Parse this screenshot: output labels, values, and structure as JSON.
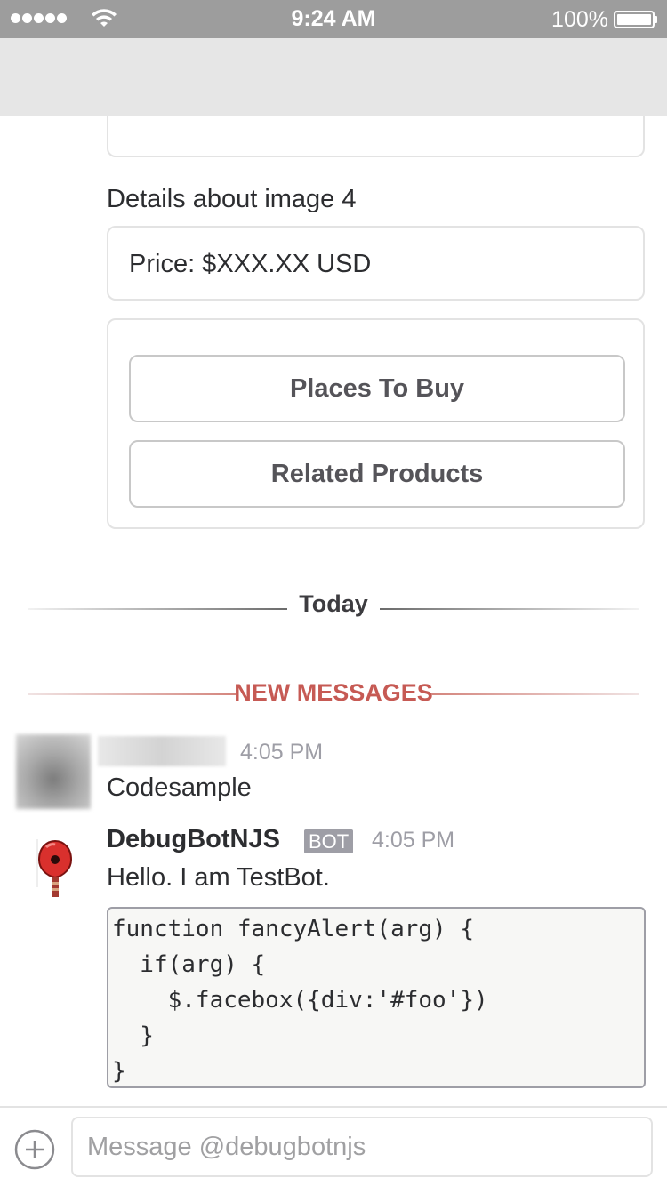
{
  "status_bar": {
    "time": "9:24 AM",
    "battery_percent": "100%",
    "signal_bars": 5,
    "icons": [
      "signal-dots-icon",
      "wifi-icon",
      "battery-icon"
    ]
  },
  "attachment_card": {
    "details_text": "Details about image 4",
    "price_text": "Price: $XXX.XX USD",
    "buttons": [
      {
        "label": "Places To Buy"
      },
      {
        "label": "Related Products"
      }
    ]
  },
  "dividers": {
    "day_label": "Today",
    "new_messages_label": "NEW MESSAGES"
  },
  "messages": [
    {
      "time": "4:05 PM",
      "text": "Codesample"
    },
    {
      "sender": "DebugBotNJS",
      "badge": "BOT",
      "time": "4:05 PM",
      "text": "Hello. I am TestBot.",
      "code_lines": [
        "function fancyAlert(arg) {",
        "  if(arg) {",
        "    $.facebox({div:'#foo'})",
        "  }",
        "}"
      ]
    }
  ],
  "compose": {
    "placeholder": "Message @debugbotnjs",
    "value": "",
    "attach_icon": "plus-circle-icon"
  },
  "colors": {
    "status_bar": "#9d9d9d",
    "nav_bar": "#e6e6e6",
    "new_messages": "#c65a54",
    "bot_badge": "#9e9ea6"
  }
}
